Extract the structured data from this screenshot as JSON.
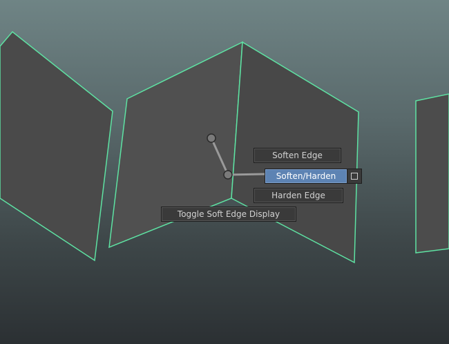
{
  "marking_menu": {
    "soften_edge": "Soften Edge",
    "soften_harden": "Soften/Harden",
    "harden_edge": "Harden Edge",
    "toggle_soft_edge_display": "Toggle Soft Edge Display"
  },
  "colors": {
    "wireframe_highlight": "#5ee3a3",
    "face_fill": "#4b4b4b",
    "menu_bg": "#3a3a3a",
    "menu_active_bg": "#5d83b3",
    "menu_text": "#d2d2d2"
  },
  "icons": {
    "option_box": "option-box-icon"
  }
}
